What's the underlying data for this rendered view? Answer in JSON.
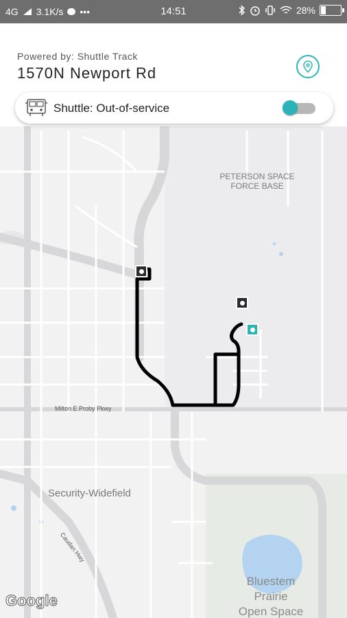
{
  "status_bar": {
    "network": "4G",
    "speed": "3.1K/s",
    "dots": "•••",
    "time": "14:51",
    "battery": "28%"
  },
  "header": {
    "powered_by": "Powered by: Shuttle Track",
    "address": "1570N Newport Rd"
  },
  "shuttle_card": {
    "status_label": "Shuttle: Out-of-service",
    "toggle_on": true
  },
  "map": {
    "labels": {
      "peterson_1": "PETERSON SPACE",
      "peterson_2": "FORCE BASE",
      "milton": "Milton E Proby Pkwy",
      "security": "Security-Widefield",
      "bluestem_1": "Bluestem",
      "bluestem_2": "Prairie",
      "bluestem_3": "Open Space",
      "caudan": "Caudan Hwy"
    },
    "attribution": "Google"
  },
  "colors": {
    "accent": "#2bb3b8",
    "route": "#000000",
    "water": "#b3d3f0"
  }
}
